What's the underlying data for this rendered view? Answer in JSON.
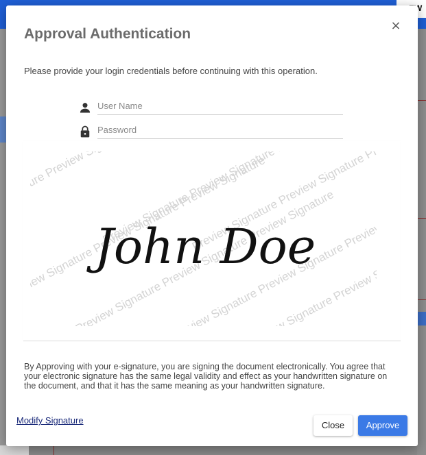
{
  "background": {
    "topright_text": "EW"
  },
  "dialog": {
    "title": "Approval Authentication",
    "close_symbol": "×",
    "intro": "Please provide your login credentials before continuing with this operation.",
    "username_placeholder": "User Name",
    "username_value": "",
    "password_placeholder": "Password",
    "password_value": "",
    "signature": {
      "name": "John Doe",
      "watermark": "Preview Signature Preview Signature Preview Signature"
    },
    "legal_text": "By Approving with your e-signature, you are signing the document electronically. You agree that your electronic signature has the same legal validity and effect as your handwritten signature on the document, and that it has the same meaning as your handwritten signature.",
    "modify_link": "Modify Signature",
    "close_label": "Close",
    "approve_label": "Approve"
  },
  "icons": {
    "user": "person-icon",
    "password": "lock-icon",
    "close": "close-icon"
  },
  "colors": {
    "accent": "#3b7ae6",
    "header": "#1f5fd6",
    "link": "#1a2a7a",
    "title": "#6b6b6b"
  }
}
